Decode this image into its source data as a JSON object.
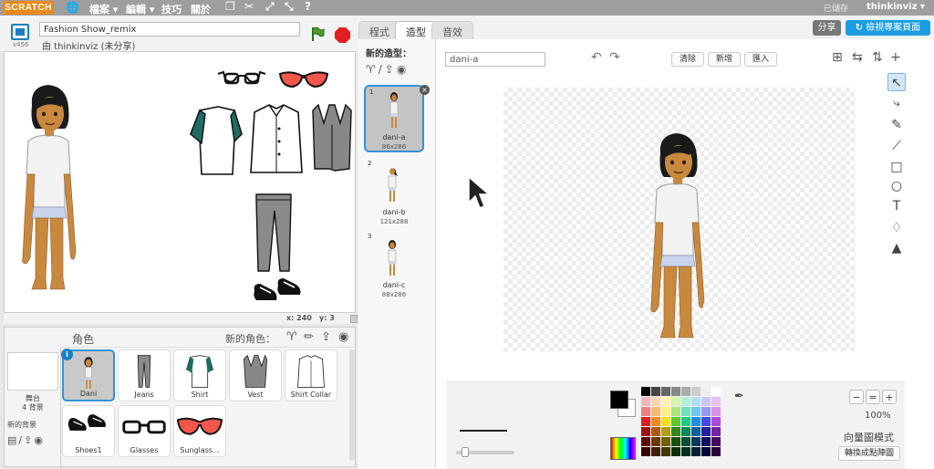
{
  "topbar": {
    "logo": "SCRATCH",
    "menus": [
      "檔案",
      "編輯",
      "技巧",
      "關於"
    ],
    "saved_status": "已儲存",
    "username": "thinkinviz"
  },
  "stage_header": {
    "version": "v456",
    "project_title": "Fashion Show_remix",
    "byline": "由 thinkinviz (未分享)"
  },
  "coords": {
    "x_label": "x:",
    "x": "240",
    "y_label": "y:",
    "y": "3"
  },
  "sprites": {
    "header_label": "角色",
    "new_sprite_label": "新的角色：",
    "stage_label": "舞台",
    "stage_count": "4 背景",
    "new_backdrop_label": "新的背景",
    "items": [
      {
        "name": "Dani"
      },
      {
        "name": "Jeans"
      },
      {
        "name": "Shirt"
      },
      {
        "name": "Vest"
      },
      {
        "name": "Shirt Collar"
      },
      {
        "name": "Shoes1"
      },
      {
        "name": "Glasses"
      },
      {
        "name": "Sunglass..."
      }
    ]
  },
  "tabs": [
    {
      "label": "程式"
    },
    {
      "label": "造型"
    },
    {
      "label": "音效"
    }
  ],
  "header_buttons": {
    "share": "分享",
    "see_project": "檢視專案頁面"
  },
  "costumes": {
    "new_costume_label": "新的造型：",
    "items": [
      {
        "number": "1",
        "name": "dani-a",
        "size": "86x286"
      },
      {
        "number": "2",
        "name": "dani-b",
        "size": "121x288"
      },
      {
        "number": "3",
        "name": "dani-c",
        "size": "88x286"
      }
    ]
  },
  "paint": {
    "costume_name": "dani-a",
    "clear_label": "清除",
    "add_label": "新增",
    "import_label": "匯入",
    "zoom_level": "100%",
    "mode_label": "向量圖模式",
    "convert_label": "轉換成點陣圖"
  },
  "colors": {
    "accent": "#3393d2",
    "topbar": "#9e9e9e",
    "logo": "#e98a1b",
    "skin": "#c8893f",
    "hair": "#1a1a1a",
    "teal": "#1f6b66",
    "sunglass_lens": "#f2574c"
  },
  "icons": {
    "menu": [
      "globe-icon",
      "duplicate-icon",
      "cut-icon",
      "grow-icon",
      "shrink-icon",
      "help-icon"
    ],
    "tools": [
      "select-icon",
      "reshape-icon",
      "pencil-icon",
      "line-icon",
      "rectangle-icon",
      "ellipse-icon",
      "text-icon",
      "fill-icon",
      "stamp-icon"
    ]
  }
}
